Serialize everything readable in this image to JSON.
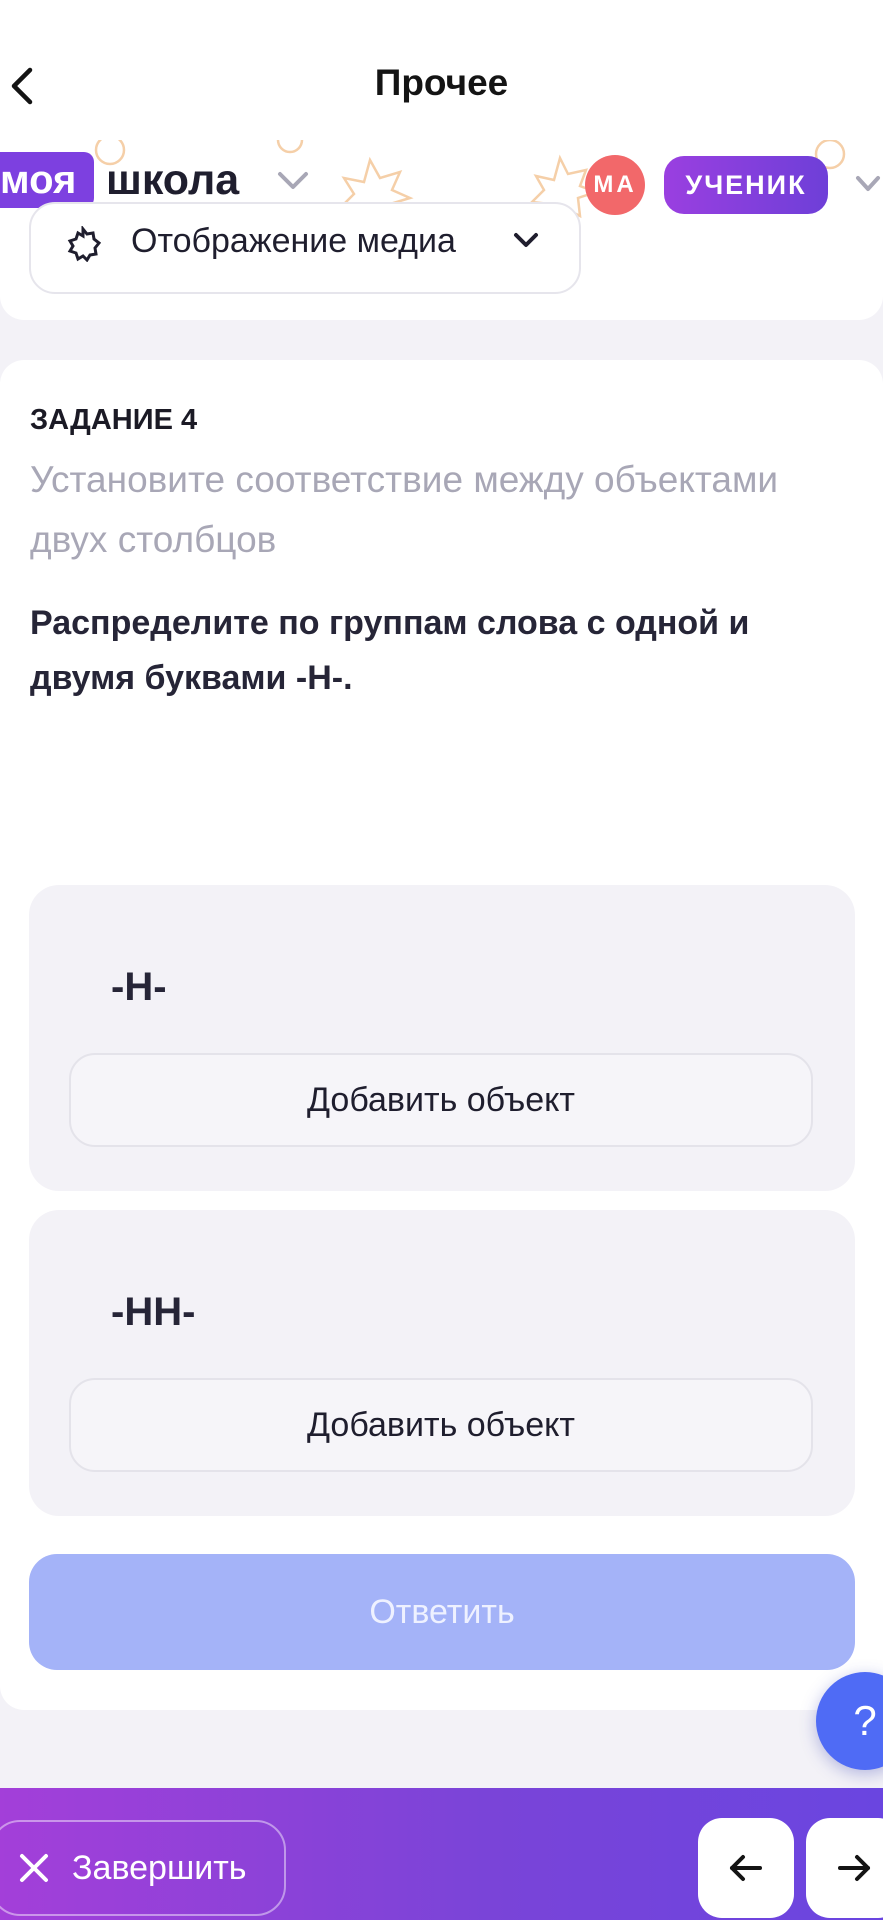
{
  "header": {
    "title": "Прочее"
  },
  "school": {
    "logo_box": "моя",
    "logo_word": "школа",
    "avatar_initials": "МА",
    "role": "УЧЕНИК"
  },
  "media": {
    "label": "Отображение медиа"
  },
  "task": {
    "number": "ЗАДАНИЕ 4",
    "type": "Установите соответствие между объектами двух столбцов",
    "question": "Распределите по группам слова с одной и двумя буквами -Н-.",
    "groups": [
      {
        "title": "-Н-",
        "add_label": "Добавить объект"
      },
      {
        "title": "-НН-",
        "add_label": "Добавить объект"
      }
    ],
    "answer_label": "Ответить"
  },
  "help": {
    "label": "?"
  },
  "footer": {
    "finish_label": "Завершить"
  },
  "colors": {
    "accent": "#7d40e0",
    "answer_disabled": "#a4b3f8",
    "avatar": "#f2686a",
    "help": "#4f6bf5"
  }
}
